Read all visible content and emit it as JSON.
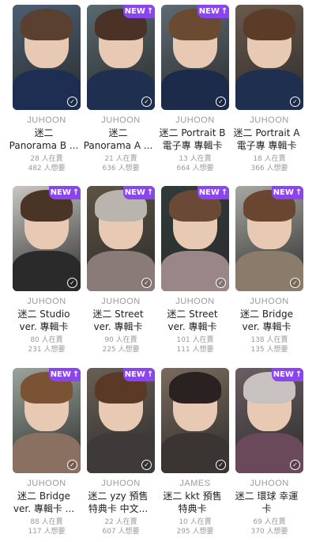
{
  "cards": [
    {
      "group": "JUHOON",
      "title1": "迷二",
      "title2": "Panorama B ...",
      "stat1": "28 人在賣",
      "stat2": "482 人想要",
      "new": false,
      "badge": "",
      "bg": "#4a5e72",
      "body": "#1e2d52",
      "hair": "#5a4030"
    },
    {
      "group": "JUHOON",
      "title1": "迷二",
      "title2": "Panorama A ...",
      "stat1": "21 人在賣",
      "stat2": "636 人想要",
      "new": true,
      "badge": "NEW",
      "bg": "#58696f",
      "body": "#1f2f4f",
      "hair": "#4a3326"
    },
    {
      "group": "JUHOON",
      "title1": "迷二 Portrait B",
      "title2": "電子專 專輯卡",
      "stat1": "13 人在賣",
      "stat2": "664 人想要",
      "new": true,
      "badge": "NEW",
      "bg": "#5d6a74",
      "body": "#1c2b4a",
      "hair": "#6a4a30"
    },
    {
      "group": "JUHOON",
      "title1": "迷二 Portrait A",
      "title2": "電子專 專輯卡",
      "stat1": "18 人在賣",
      "stat2": "366 人想要",
      "new": false,
      "badge": "",
      "bg": "#6a5a4c",
      "body": "#1f2f50",
      "hair": "#5a3c28"
    },
    {
      "group": "JUHOON",
      "title1": "迷二 Studio",
      "title2": "ver. 專輯卡",
      "stat1": "80 人在賣",
      "stat2": "231 人想要",
      "new": true,
      "badge": "NEW",
      "bg": "#c9c6c2",
      "body": "#2a2a2a",
      "hair": "#4a3426"
    },
    {
      "group": "JUHOON",
      "title1": "迷二 Street",
      "title2": "ver. 專輯卡",
      "stat1": "90 人在賣",
      "stat2": "225 人想要",
      "new": true,
      "badge": "NEW",
      "bg": "#5e5344",
      "body": "#8a7a78",
      "hair": "#b9b4ae"
    },
    {
      "group": "JUHOON",
      "title1": "迷二 Street",
      "title2": "ver. 專輯卡",
      "stat1": "101 人在賣",
      "stat2": "111 人想要",
      "new": true,
      "badge": "NEW",
      "bg": "#2f3b3a",
      "body": "#9a8686",
      "hair": "#6a4a36"
    },
    {
      "group": "JUHOON",
      "title1": "迷二 Bridge",
      "title2": "ver. 專輯卡",
      "stat1": "138 人在賣",
      "stat2": "135 人想要",
      "new": true,
      "badge": "NEW",
      "bg": "#a7a7a2",
      "body": "#8b7b6a",
      "hair": "#6a4630"
    },
    {
      "group": "JUHOON",
      "title1": "迷二 Bridge",
      "title2": "ver. 專輯卡 ...",
      "stat1": "88 人在賣",
      "stat2": "117 人想要",
      "new": true,
      "badge": "NEW",
      "bg": "#9aa59b",
      "body": "#8a7060",
      "hair": "#7a5234"
    },
    {
      "group": "JUHOON",
      "title1": "迷二 yzy 預售",
      "title2": "特典卡 中文...",
      "stat1": "22 人在賣",
      "stat2": "607 人想要",
      "new": true,
      "badge": "NEW",
      "bg": "#6a5f56",
      "body": "#3e3a3a",
      "hair": "#5a3a26"
    },
    {
      "group": "JAMES",
      "title1": "迷二 kkt 預售",
      "title2": "特典卡",
      "stat1": "10 人在賣",
      "stat2": "295 人想要",
      "new": false,
      "badge": "",
      "bg": "#7a6a5c",
      "body": "#3a3532",
      "hair": "#2a2220"
    },
    {
      "group": "JUHOON",
      "title1": "迷二 環球 幸運",
      "title2": "卡",
      "stat1": "69 人在賣",
      "stat2": "370 人想要",
      "new": true,
      "badge": "NEW",
      "bg": "#6a5e64",
      "body": "#6a4a5a",
      "hair": "#c7c2c0"
    }
  ],
  "colors": {
    "accent": "#8b45f0",
    "muted": "#9a9a9a",
    "text": "#222222"
  },
  "icons": {
    "badge_arrow": "arrow-up-icon",
    "owned": "check-circle-icon"
  }
}
